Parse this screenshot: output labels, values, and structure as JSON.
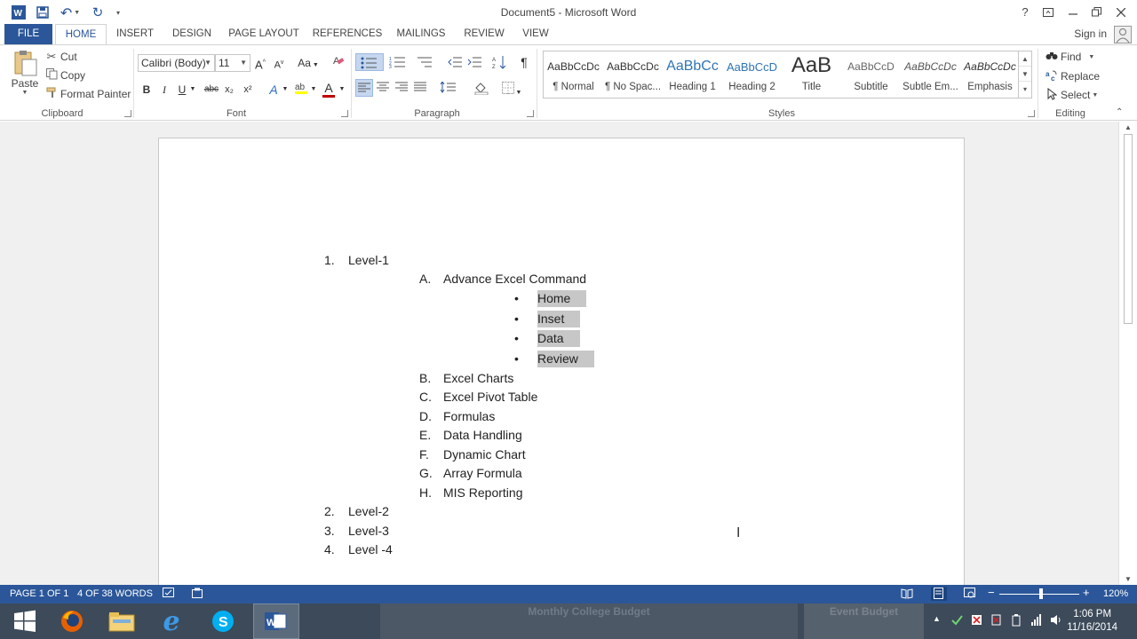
{
  "window": {
    "title": "Document5 - Microsoft Word",
    "help": "?",
    "sign_in": "Sign in"
  },
  "tabs": [
    "FILE",
    "HOME",
    "INSERT",
    "DESIGN",
    "PAGE LAYOUT",
    "REFERENCES",
    "MAILINGS",
    "REVIEW",
    "VIEW"
  ],
  "ribbon": {
    "clipboard": {
      "label": "Clipboard",
      "paste": "Paste",
      "cut": "Cut",
      "copy": "Copy",
      "format_painter": "Format Painter"
    },
    "font": {
      "label": "Font",
      "family": "Calibri (Body)",
      "size": "11",
      "grow": "A",
      "shrink": "A",
      "case": "Aa",
      "bold": "B",
      "italic": "I",
      "underline": "U",
      "strike": "abc",
      "subscript": "x₂",
      "superscript": "x²",
      "effects": "A",
      "font_color": "A"
    },
    "paragraph": {
      "label": "Paragraph",
      "pilcrow": "¶"
    },
    "styles": {
      "label": "Styles",
      "items": [
        {
          "sample": "AaBbCcDc",
          "name": "¶ Normal"
        },
        {
          "sample": "AaBbCcDc",
          "name": "¶ No Spac..."
        },
        {
          "sample": "AaBbCc",
          "name": "Heading 1"
        },
        {
          "sample": "AaBbCcD",
          "name": "Heading 2"
        },
        {
          "sample": "AaB",
          "name": "Title"
        },
        {
          "sample": "AaBbCcD",
          "name": "Subtitle"
        },
        {
          "sample": "AaBbCcDc",
          "name": "Subtle Em..."
        },
        {
          "sample": "AaBbCcDc",
          "name": "Emphasis"
        }
      ]
    },
    "editing": {
      "label": "Editing",
      "find": "Find",
      "replace": "Replace",
      "select": "Select"
    }
  },
  "document": {
    "items": [
      {
        "num": "1.",
        "text": "Level-1"
      },
      {
        "num": "A.",
        "text": "Advance Excel Command"
      },
      {
        "num": "•",
        "text": "Home"
      },
      {
        "num": "•",
        "text": "Inset"
      },
      {
        "num": "•",
        "text": "Data"
      },
      {
        "num": "•",
        "text": "Review"
      },
      {
        "num": "B.",
        "text": "Excel Charts"
      },
      {
        "num": "C.",
        "text": "Excel Pivot Table"
      },
      {
        "num": "D.",
        "text": "Formulas"
      },
      {
        "num": "E.",
        "text": "Data Handling"
      },
      {
        "num": "F.",
        "text": "Dynamic Chart"
      },
      {
        "num": "G.",
        "text": "Array Formula"
      },
      {
        "num": "H.",
        "text": "MIS Reporting"
      },
      {
        "num": "2.",
        "text": "Level-2"
      },
      {
        "num": "3.",
        "text": "Level-3"
      },
      {
        "num": "4.",
        "text": "Level -4"
      }
    ]
  },
  "status": {
    "page": "PAGE 1 OF 1",
    "words": "4 OF 38 WORDS",
    "zoom": "120%"
  },
  "taskbar": {
    "blurred_1": "Monthly College Budget",
    "blurred_2": "Event Budget",
    "time": "1:06 PM",
    "date": "11/16/2014"
  },
  "colors": {
    "word_blue": "#2b579a",
    "highlight_gray": "#c7c7c7",
    "taskbar": "#3c4a5a"
  }
}
